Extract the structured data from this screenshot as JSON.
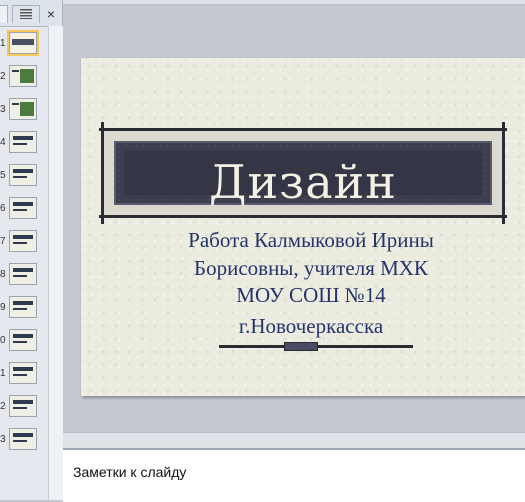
{
  "left_pane": {
    "tab_slides_label": "",
    "tab_outline_icon": "outline-list-icon",
    "close_label": "×",
    "thumbnails": [
      {
        "number": "1",
        "kind": "title"
      },
      {
        "number": "2",
        "kind": "image"
      },
      {
        "number": "3",
        "kind": "image"
      },
      {
        "number": "4",
        "kind": "text"
      },
      {
        "number": "5",
        "kind": "text"
      },
      {
        "number": "6",
        "kind": "text"
      },
      {
        "number": "7",
        "kind": "text"
      },
      {
        "number": "8",
        "kind": "text"
      },
      {
        "number": "9",
        "kind": "text"
      },
      {
        "number": "0",
        "kind": "text"
      },
      {
        "number": "1",
        "kind": "text"
      },
      {
        "number": "2",
        "kind": "text"
      },
      {
        "number": "3",
        "kind": "text"
      }
    ]
  },
  "slide": {
    "title": "Дизайн",
    "subtitle_lines": [
      "Работа Калмыковой Ирины",
      "Борисовны,  учителя МХК",
      "МОУ СОШ №14",
      "г.Новочеркасска"
    ],
    "colors": {
      "background": "#ecebe0",
      "band": "#3c3d4d",
      "title_text": "#f4f1e4",
      "subtitle_text": "#23356b"
    }
  },
  "notes": {
    "placeholder": "Заметки к слайду"
  }
}
